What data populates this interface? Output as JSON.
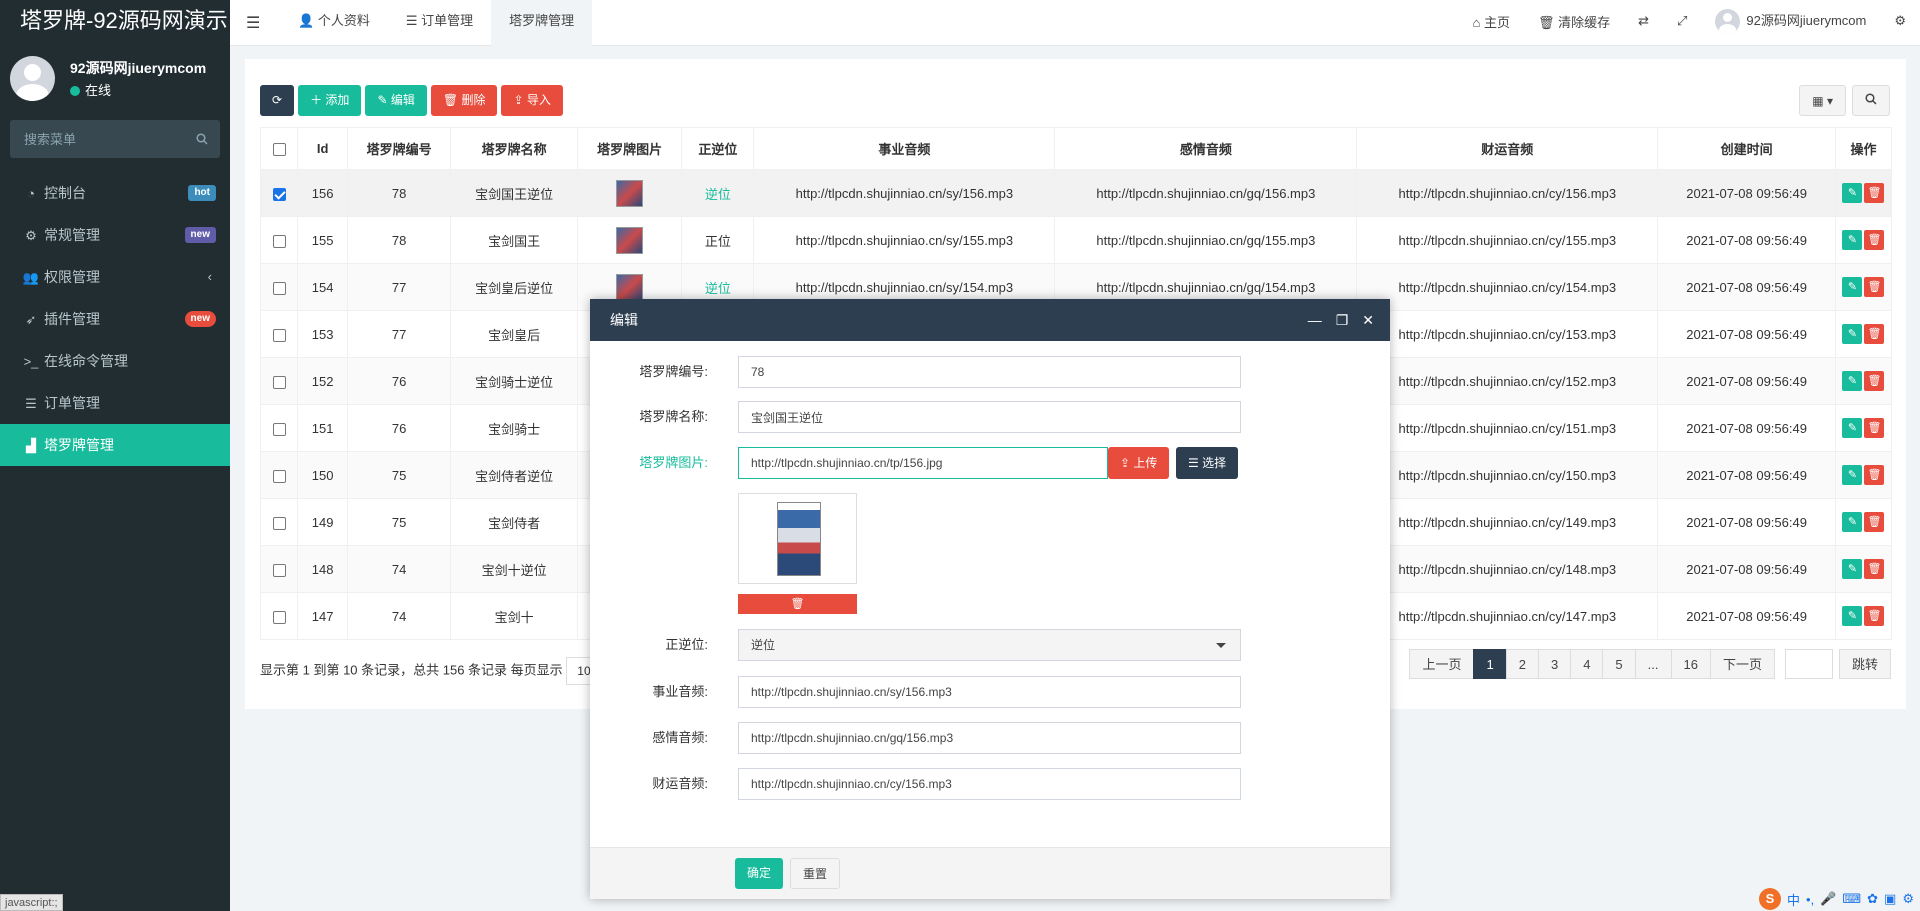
{
  "sidebar": {
    "logo": "塔罗牌-92源码网演示",
    "user_name": "92源码网jiuerymcom",
    "user_status": "在线",
    "search_placeholder": "搜索菜单",
    "items": [
      {
        "icon": "dashboard-icon",
        "glyph": "◔",
        "label": "控制台",
        "badge": "hot"
      },
      {
        "icon": "cogs-icon",
        "glyph": "⚙",
        "label": "常规管理",
        "badge": "new"
      },
      {
        "icon": "users-icon",
        "glyph": "👥",
        "label": "权限管理",
        "badge": "",
        "chevron": "‹"
      },
      {
        "icon": "rocket-icon",
        "glyph": "➶",
        "label": "插件管理",
        "badge": "new"
      },
      {
        "icon": "terminal-icon",
        "glyph": ">_",
        "label": "在线命令管理",
        "badge": ""
      },
      {
        "icon": "list-icon",
        "glyph": "☰",
        "label": "订单管理",
        "badge": ""
      },
      {
        "icon": "chart-icon",
        "glyph": "▟",
        "label": "塔罗牌管理",
        "badge": "",
        "active": true
      }
    ]
  },
  "topbar": {
    "tabs": [
      {
        "icon": "user-icon",
        "glyph": "👤",
        "label": "个人资料"
      },
      {
        "icon": "list-icon",
        "glyph": "☰",
        "label": "订单管理"
      },
      {
        "label": "塔罗牌管理",
        "active": true
      }
    ],
    "home": "主页",
    "clear_cache": "清除缓存",
    "username": "92源码网jiuerymcom"
  },
  "toolbar": {
    "add": "添加",
    "edit": "编辑",
    "delete": "删除",
    "import": "导入"
  },
  "table": {
    "headers": [
      "Id",
      "塔罗牌编号",
      "塔罗牌名称",
      "塔罗牌图片",
      "正逆位",
      "事业音频",
      "感情音频",
      "财运音频",
      "创建时间",
      "操作"
    ],
    "rows": [
      {
        "id": "156",
        "num": "78",
        "name": "宝剑国王逆位",
        "pos": "逆位",
        "sy": "http://tlpcdn.shujinniao.cn/sy/156.mp3",
        "gq": "http://tlpcdn.shujinniao.cn/gq/156.mp3",
        "cy": "http://tlpcdn.shujinniao.cn/cy/156.mp3",
        "time": "2021-07-08 09:56:49",
        "checked": true
      },
      {
        "id": "155",
        "num": "78",
        "name": "宝剑国王",
        "pos": "正位",
        "sy": "http://tlpcdn.shujinniao.cn/sy/155.mp3",
        "gq": "http://tlpcdn.shujinniao.cn/gq/155.mp3",
        "cy": "http://tlpcdn.shujinniao.cn/cy/155.mp3",
        "time": "2021-07-08 09:56:49"
      },
      {
        "id": "154",
        "num": "77",
        "name": "宝剑皇后逆位",
        "pos": "逆位",
        "sy": "http://tlpcdn.shujinniao.cn/sy/154.mp3",
        "gq": "http://tlpcdn.shujinniao.cn/gq/154.mp3",
        "cy": "http://tlpcdn.shujinniao.cn/cy/154.mp3",
        "time": "2021-07-08 09:56:49"
      },
      {
        "id": "153",
        "num": "77",
        "name": "宝剑皇后",
        "pos": "",
        "sy": "",
        "gq": "",
        "cy": "http://tlpcdn.shujinniao.cn/cy/153.mp3",
        "time": "2021-07-08 09:56:49"
      },
      {
        "id": "152",
        "num": "76",
        "name": "宝剑骑士逆位",
        "pos": "",
        "sy": "",
        "gq": "",
        "cy": "http://tlpcdn.shujinniao.cn/cy/152.mp3",
        "time": "2021-07-08 09:56:49"
      },
      {
        "id": "151",
        "num": "76",
        "name": "宝剑骑士",
        "pos": "",
        "sy": "",
        "gq": "",
        "cy": "http://tlpcdn.shujinniao.cn/cy/151.mp3",
        "time": "2021-07-08 09:56:49"
      },
      {
        "id": "150",
        "num": "75",
        "name": "宝剑侍者逆位",
        "pos": "",
        "sy": "",
        "gq": "",
        "cy": "http://tlpcdn.shujinniao.cn/cy/150.mp3",
        "time": "2021-07-08 09:56:49"
      },
      {
        "id": "149",
        "num": "75",
        "name": "宝剑侍者",
        "pos": "",
        "sy": "",
        "gq": "",
        "cy": "http://tlpcdn.shujinniao.cn/cy/149.mp3",
        "time": "2021-07-08 09:56:49"
      },
      {
        "id": "148",
        "num": "74",
        "name": "宝剑十逆位",
        "pos": "",
        "sy": "",
        "gq": "",
        "cy": "http://tlpcdn.shujinniao.cn/cy/148.mp3",
        "time": "2021-07-08 09:56:49"
      },
      {
        "id": "147",
        "num": "74",
        "name": "宝剑十",
        "pos": "",
        "sy": "",
        "gq": "",
        "cy": "http://tlpcdn.shujinniao.cn/cy/147.mp3",
        "time": "2021-07-08 09:56:49"
      }
    ]
  },
  "pager": {
    "info": "显示第 1 到第 10 条记录，总共 156 条记录 每页显示",
    "page_size": "10",
    "prev": "上一页",
    "pages": [
      "1",
      "2",
      "3",
      "4",
      "5",
      "...",
      "16"
    ],
    "next": "下一页",
    "go": "跳转"
  },
  "modal": {
    "title": "编辑",
    "fields": {
      "num_label": "塔罗牌编号:",
      "num_value": "78",
      "name_label": "塔罗牌名称:",
      "name_value": "宝剑国王逆位",
      "image_label": "塔罗牌图片:",
      "image_value": "http://tlpcdn.shujinniao.cn/tp/156.jpg",
      "upload": "上传",
      "choose": "选择",
      "pos_label": "正逆位:",
      "pos_value": "逆位",
      "sy_label": "事业音频:",
      "sy_value": "http://tlpcdn.shujinniao.cn/sy/156.mp3",
      "gq_label": "感情音频:",
      "gq_value": "http://tlpcdn.shujinniao.cn/gq/156.mp3",
      "cy_label": "财运音频:",
      "cy_value": "http://tlpcdn.shujinniao.cn/cy/156.mp3"
    },
    "confirm": "确定",
    "reset": "重置"
  },
  "statusbar": "javascript:;",
  "ime": {
    "logo": "S",
    "lang": "中"
  },
  "colors": {
    "accent": "#18bc9c",
    "dark": "#2c3e50",
    "danger": "#e74c3c",
    "sidebar": "#222d32"
  }
}
